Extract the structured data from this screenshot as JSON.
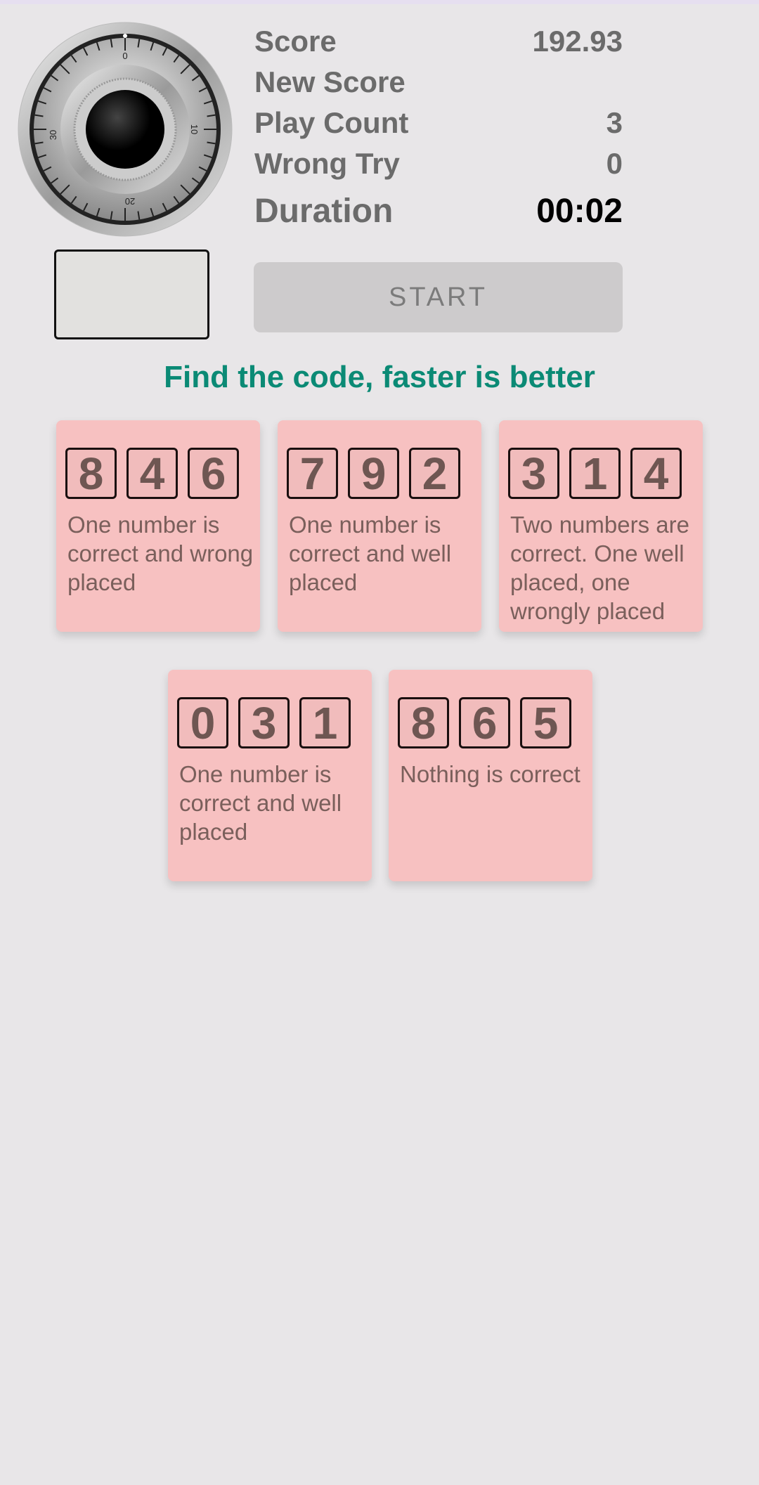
{
  "stats": {
    "score": {
      "label": "Score",
      "value": "192.93"
    },
    "new_score": {
      "label": "New Score",
      "value": ""
    },
    "play_count": {
      "label": "Play Count",
      "value": "3"
    },
    "wrong_try": {
      "label": "Wrong Try",
      "value": "0"
    },
    "duration": {
      "label": "Duration",
      "value": "00:02"
    }
  },
  "dial": {
    "labels": [
      "0",
      "10",
      "20",
      "30"
    ]
  },
  "start_label": "START",
  "heading": "Find the code, faster is better",
  "colors": {
    "accent": "#0b8a75",
    "card": "#f7c1c1",
    "background": "#e8e6e8"
  },
  "clues": [
    {
      "digits": [
        "8",
        "4",
        "6"
      ],
      "hint": "One number is correct and wrong placed"
    },
    {
      "digits": [
        "7",
        "9",
        "2"
      ],
      "hint": "One number is correct and well placed"
    },
    {
      "digits": [
        "3",
        "1",
        "4"
      ],
      "hint": "Two numbers are correct. One well placed, one wrongly placed"
    },
    {
      "digits": [
        "0",
        "3",
        "1"
      ],
      "hint": "One number is correct and well placed"
    },
    {
      "digits": [
        "8",
        "6",
        "5"
      ],
      "hint": "Nothing is correct"
    }
  ]
}
